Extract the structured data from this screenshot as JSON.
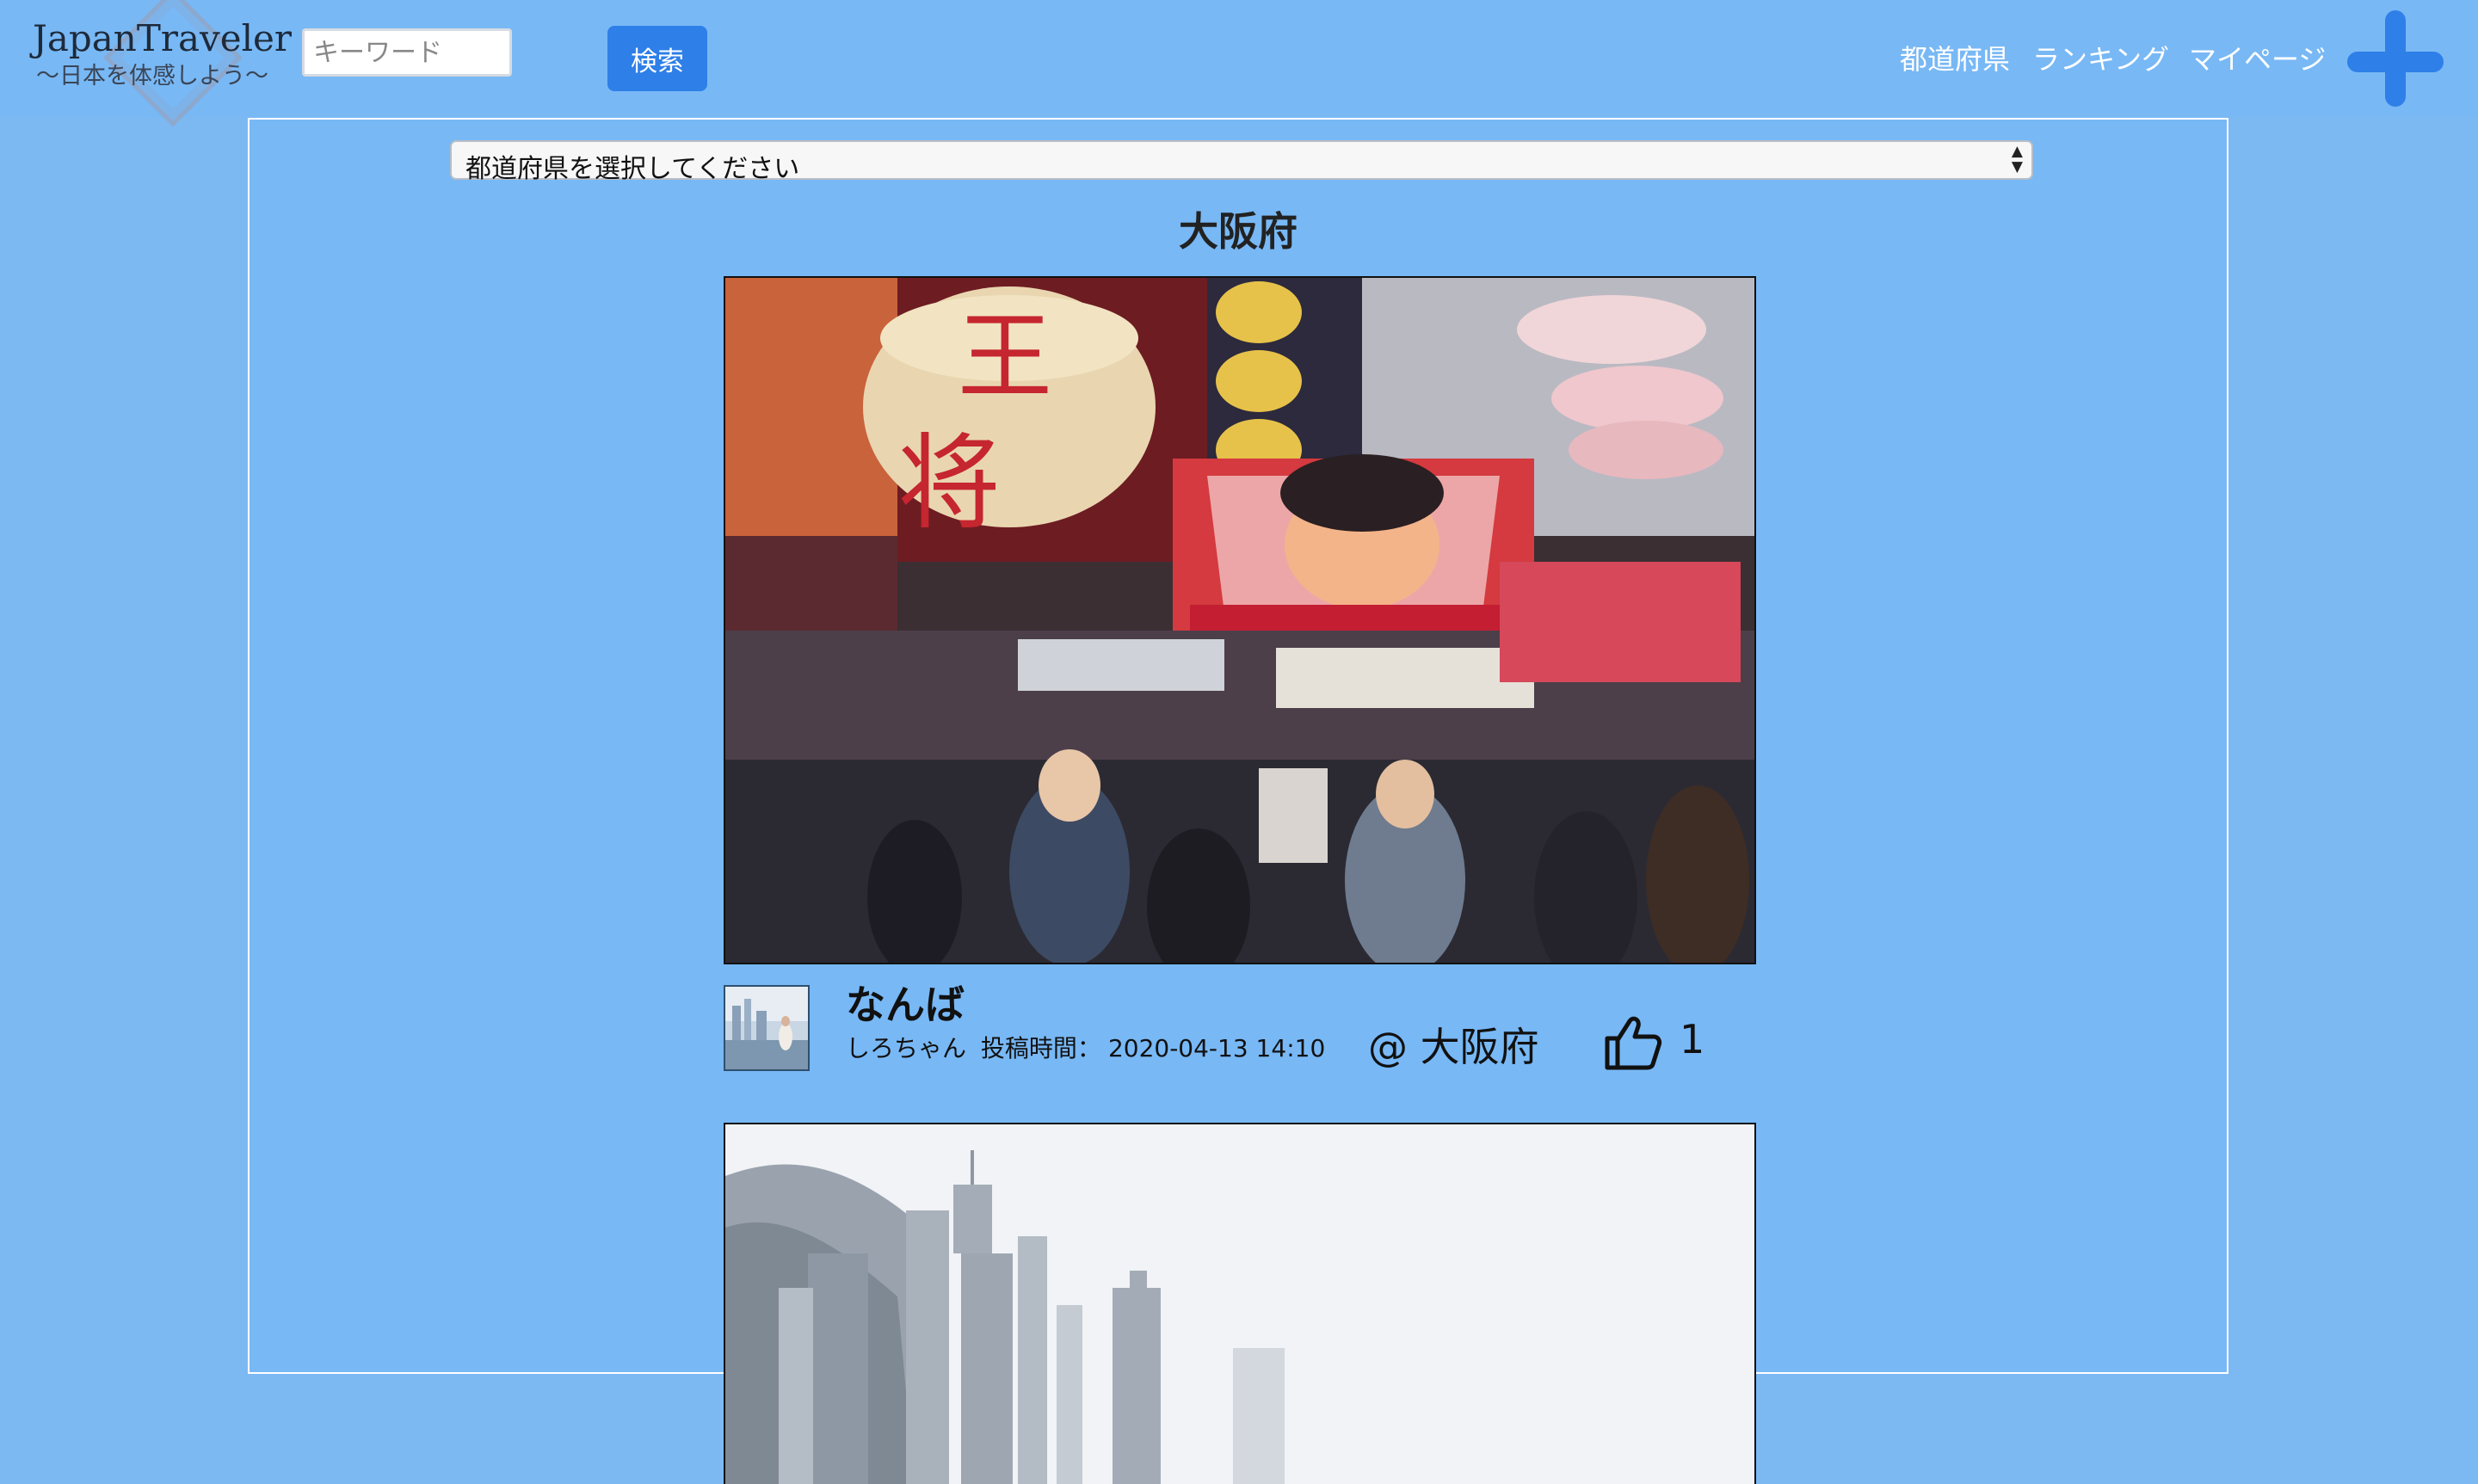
{
  "header": {
    "logo_title": "JapanTraveler",
    "logo_subtitle": "〜日本を体感しよう〜",
    "search_placeholder": "キーワード",
    "search_button": "検索",
    "nav": [
      "都道府県",
      "ランキング",
      "マイページ"
    ],
    "add_icon": "plus-icon"
  },
  "filter": {
    "select_value": "都道府県を選択してください",
    "arrows_up": "▲",
    "arrows_down": "▼"
  },
  "page_heading": "大阪府",
  "posts": [
    {
      "title": "なんば",
      "author": "しろちゃん",
      "time_label": "投稿時間：",
      "time": "2020-04-13 14:10",
      "location": "@ 大阪府",
      "like_icon": "thumbs-up-icon",
      "likes": "1"
    }
  ],
  "colors": {
    "background": "#78b8f5",
    "accent": "#2e7fe8",
    "nav_text": "#ffffff"
  }
}
